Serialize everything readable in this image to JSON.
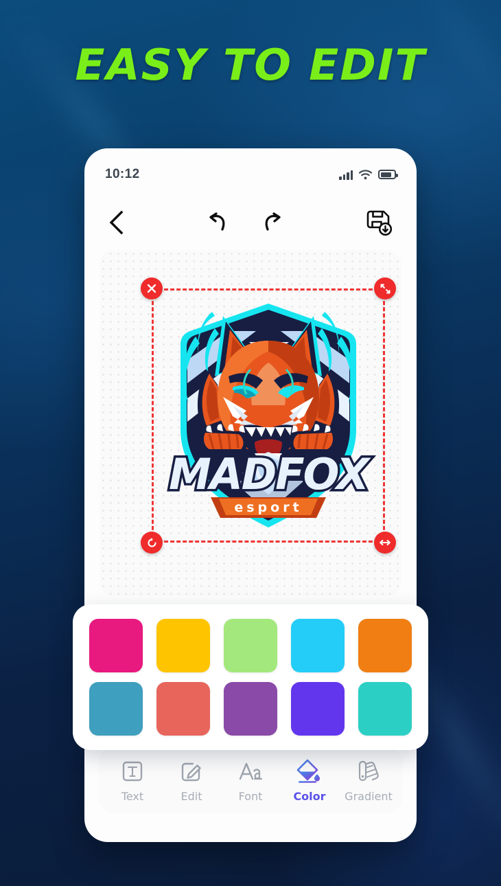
{
  "headline": {
    "text": "EASY TO EDIT",
    "color": "#7aee19"
  },
  "background": {
    "top_color": "#0b4c7d",
    "bottom_color": "#0a1b38"
  },
  "phone": {
    "status_bar": {
      "time": "10:12",
      "signal_icon": "signal-bars-icon",
      "wifi_icon": "wifi-icon",
      "battery_icon": "battery-icon"
    },
    "toolbar": {
      "back_label": "Back",
      "undo_label": "Undo",
      "redo_label": "Redo",
      "save_label": "Save"
    },
    "canvas": {
      "selection": {
        "border_color": "#ef3434",
        "handle_color": "#ef2b2b",
        "delete_label": "Delete",
        "scale_label": "Scale",
        "rotate_label": "Rotate",
        "flip_label": "Flip"
      },
      "artwork": {
        "title": "MADFOX",
        "subtitle": "esport",
        "primary_color": "#ea5a1d",
        "accent_color": "#16e5f0",
        "dark_color": "#131a3f"
      }
    },
    "palette": {
      "row1": [
        {
          "name": "pink",
          "hex": "#e8197f"
        },
        {
          "name": "yellow",
          "hex": "#ffc400"
        },
        {
          "name": "lightgreen",
          "hex": "#a3e87c"
        },
        {
          "name": "cyan",
          "hex": "#23cdf7"
        },
        {
          "name": "orange",
          "hex": "#f07e13"
        }
      ],
      "row2": [
        {
          "name": "steelblue",
          "hex": "#3f9fbe"
        },
        {
          "name": "coral",
          "hex": "#e8655c"
        },
        {
          "name": "purple",
          "hex": "#8a4aa8"
        },
        {
          "name": "violet",
          "hex": "#6236ed"
        },
        {
          "name": "teal",
          "hex": "#2bcfc4"
        }
      ]
    },
    "tools": [
      {
        "label": "Text",
        "icon": "text-box-icon",
        "active": false
      },
      {
        "label": "Edit",
        "icon": "pencil-icon",
        "active": false
      },
      {
        "label": "Font",
        "icon": "font-aa-icon",
        "active": false
      },
      {
        "label": "Color",
        "icon": "paint-bucket-icon",
        "active": true
      },
      {
        "label": "Gradient",
        "icon": "swatch-fan-icon",
        "active": false
      }
    ],
    "active_tool_color": "#5a52e8"
  }
}
